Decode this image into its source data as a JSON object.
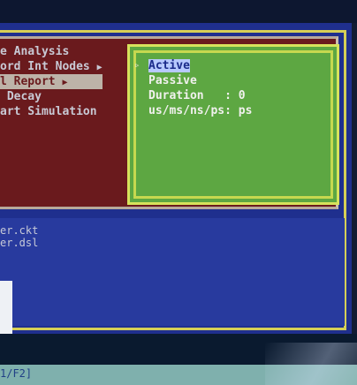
{
  "main_menu": {
    "items": [
      {
        "label": "e Analysis",
        "arrow": false
      },
      {
        "label": "ord Int Nodes",
        "arrow": true
      },
      {
        "label": "l Report",
        "arrow": true,
        "highlighted": true
      },
      {
        "label": " Decay",
        "arrow": false
      },
      {
        "label": "art Simulation",
        "arrow": false
      }
    ]
  },
  "submenu": {
    "pointer": "▹",
    "items": [
      {
        "label": "Active",
        "highlighted": true
      },
      {
        "label": "Passive"
      },
      {
        "label": "Duration   : 0"
      },
      {
        "label": "us/ms/ns/ps: ps"
      }
    ]
  },
  "files": [
    "er.ckt",
    "er.dsl"
  ],
  "status_bar": {
    "text": "1/F2]"
  },
  "colors": {
    "screen_bg": "#121b33",
    "red_pane": "#6a1a1d",
    "green_pane": "#5da742",
    "blue_pane": "#283a9e",
    "yellow_border": "#d6cf56",
    "status_bar": "#7fb0ad"
  }
}
